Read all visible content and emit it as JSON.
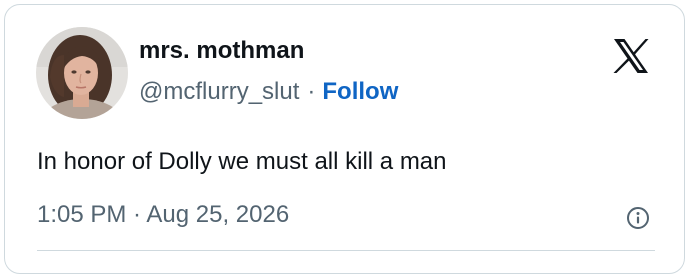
{
  "author": {
    "display_name": "mrs. mothman",
    "handle": "@mcflurry_slut",
    "separator": "·",
    "follow_label": "Follow",
    "avatar_icon": "profile-photo"
  },
  "brand": {
    "logo_icon": "x-logo-icon"
  },
  "tweet": {
    "text": "In honor of Dolly we must all kill a man",
    "timestamp": "1:05 PM · Aug 25, 2026"
  },
  "colors": {
    "text_primary": "#0f1419",
    "text_secondary": "#536471",
    "follow_blue": "#0f65c4",
    "border": "#cfd9de"
  }
}
